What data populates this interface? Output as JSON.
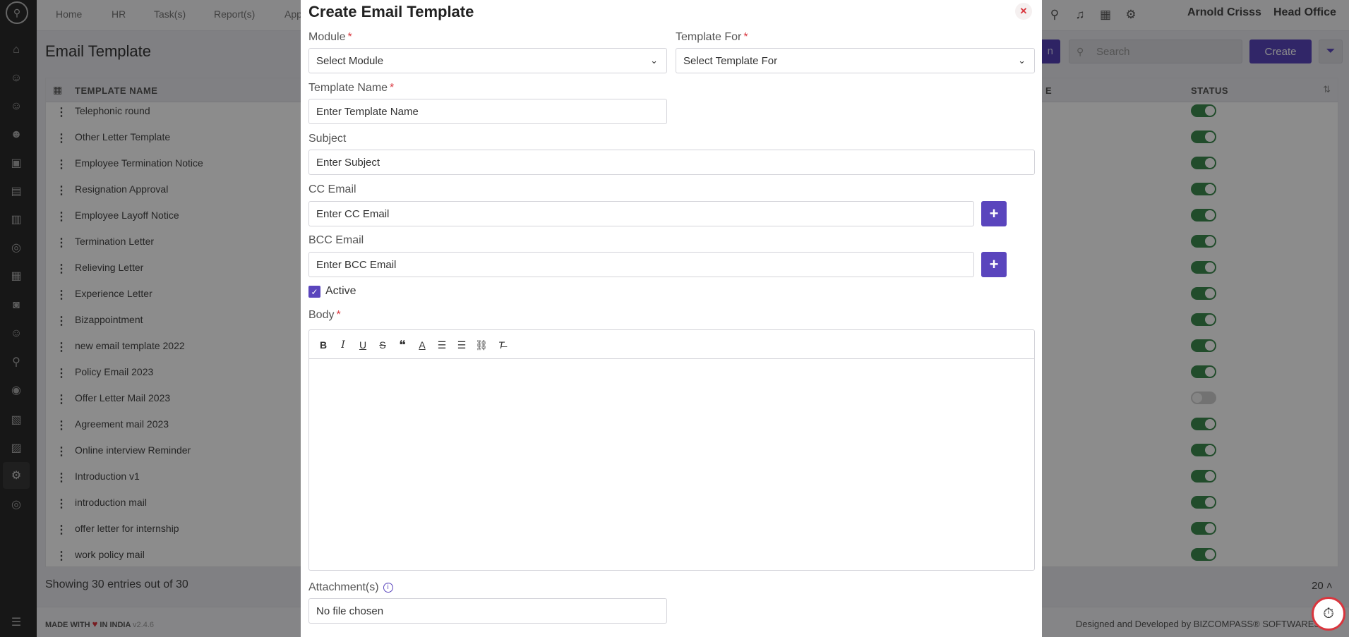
{
  "topnav": {
    "items": [
      "Home",
      "HR",
      "Task(s)",
      "Report(s)",
      "App"
    ],
    "user_name": "Arnold Crisss",
    "office": "Head Office"
  },
  "page": {
    "title": "Email Template",
    "search_placeholder": "Search",
    "create_label": "Create",
    "hidden_button_label": "n"
  },
  "table": {
    "columns": [
      "TEMPLATE NAME",
      "E",
      "STATUS"
    ],
    "rows": [
      {
        "name": "Telephonic round",
        "active": true
      },
      {
        "name": "Other Letter Template",
        "active": true
      },
      {
        "name": "Employee Termination Notice",
        "active": true
      },
      {
        "name": "Resignation Approval",
        "active": true
      },
      {
        "name": "Employee Layoff Notice",
        "active": true
      },
      {
        "name": "Termination Letter",
        "active": true
      },
      {
        "name": "Relieving Letter",
        "active": true
      },
      {
        "name": "Experience Letter",
        "active": true
      },
      {
        "name": "Bizappointment",
        "active": true
      },
      {
        "name": "new email template 2022",
        "active": true
      },
      {
        "name": "Policy Email 2023",
        "active": true
      },
      {
        "name": "Offer Letter Mail 2023",
        "active": false
      },
      {
        "name": "Agreement mail 2023",
        "active": true
      },
      {
        "name": "Online interview Reminder",
        "active": true
      },
      {
        "name": "Introduction v1",
        "active": true
      },
      {
        "name": "introduction mail",
        "active": true
      },
      {
        "name": "offer letter for internship",
        "active": true
      },
      {
        "name": "work policy mail",
        "active": true
      }
    ]
  },
  "pagination": {
    "entries_text": "Showing 30 entries out of 30",
    "page_size": "20"
  },
  "footer": {
    "made_with": "MADE WITH",
    "in_india": "IN INDIA",
    "version": "v2.4.6",
    "designed": "Designed and Developed by  BIZCOMPASS® SOFTWARES PVT"
  },
  "modal": {
    "title": "Create Email Template",
    "module_label": "Module",
    "module_value": "Select Module",
    "template_for_label": "Template For",
    "template_for_value": "Select Template For",
    "template_name_label": "Template Name",
    "template_name_placeholder": "Enter Template Name",
    "subject_label": "Subject",
    "subject_placeholder": "Enter Subject",
    "cc_label": "CC Email",
    "cc_placeholder": "Enter CC Email",
    "bcc_label": "BCC Email",
    "bcc_placeholder": "Enter BCC Email",
    "active_label": "Active",
    "active_checked": true,
    "body_label": "Body",
    "attachments_label": "Attachment(s)",
    "file_text": "No file chosen",
    "required_marker": "*"
  },
  "colors": {
    "accent": "#5a45bd",
    "toggle_on": "#3d8a4f",
    "required": "#d9363e",
    "sidebar": "#2b2b2b"
  },
  "icons": {
    "sidebar": [
      "home-icon",
      "user-add-icon",
      "user-icon",
      "users-icon",
      "id-card-icon",
      "briefcase-icon",
      "archive-icon",
      "support-icon",
      "document-icon",
      "camera-icon",
      "team-icon",
      "search-user-icon",
      "handshake-icon",
      "report-icon",
      "report2-icon",
      "settings-icon",
      "help-icon"
    ]
  }
}
